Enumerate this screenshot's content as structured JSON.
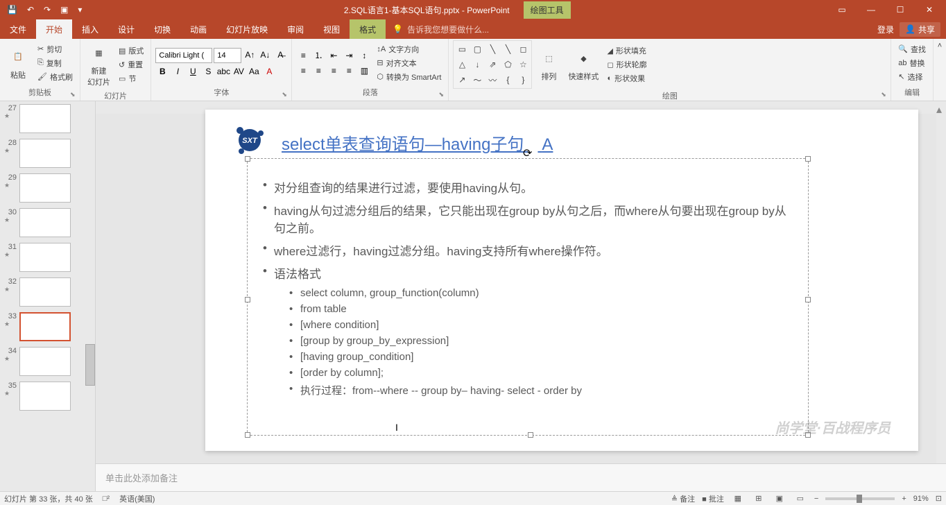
{
  "titlebar": {
    "doc_title": "2.SQL语言1-基本SQL语句.pptx - PowerPoint",
    "tool_context": "绘图工具"
  },
  "tabs": {
    "file": "文件",
    "home": "开始",
    "insert": "插入",
    "design": "设计",
    "transitions": "切换",
    "animations": "动画",
    "slideshow": "幻灯片放映",
    "review": "审阅",
    "view": "视图",
    "format": "格式",
    "tell_me": "告诉我您想要做什么...",
    "login": "登录",
    "share": "共享"
  },
  "ribbon": {
    "clipboard": {
      "label": "剪贴板",
      "paste": "粘贴",
      "cut": "剪切",
      "copy": "复制",
      "format_painter": "格式刷"
    },
    "slides": {
      "label": "幻灯片",
      "new_slide": "新建\n幻灯片",
      "layout": "版式",
      "reset": "重置",
      "section": "节"
    },
    "font": {
      "label": "字体",
      "family": "Calibri Light (",
      "size": "14"
    },
    "paragraph": {
      "label": "段落",
      "direction": "文字方向",
      "align_text": "对齐文本",
      "smartart": "转换为 SmartArt"
    },
    "drawing": {
      "label": "绘图",
      "arrange": "排列",
      "quick_styles": "快速样式",
      "fill": "形状填充",
      "outline": "形状轮廓",
      "effects": "形状效果"
    },
    "editing": {
      "label": "编辑",
      "find": "查找",
      "replace": "替换",
      "select": "选择"
    }
  },
  "thumbs": [
    {
      "num": "27"
    },
    {
      "num": "28"
    },
    {
      "num": "29"
    },
    {
      "num": "30"
    },
    {
      "num": "31"
    },
    {
      "num": "32"
    },
    {
      "num": "33",
      "selected": true
    },
    {
      "num": "34"
    },
    {
      "num": "35"
    }
  ],
  "slide": {
    "title": "select单表查询语句—having子句",
    "title_suffix": "A",
    "bullets_l1": [
      "对分组查询的结果进行过滤，要使用having从句。",
      "having从句过滤分组后的结果，它只能出现在group by从句之后，而where从句要出现在group by从句之前。",
      "where过滤行，having过滤分组。having支持所有where操作符。",
      "语法格式"
    ],
    "bullets_l2": [
      "select column, group_function(column)",
      "from table",
      "[where condition]",
      "[group by  group_by_expression]",
      "[having group_condition]",
      "[order by column];",
      "执行过程：from--where -- group  by– having- select - order  by"
    ],
    "watermark": "尚学堂·百战程序员"
  },
  "notes": {
    "placeholder": "单击此处添加备注"
  },
  "status": {
    "slide_info": "幻灯片 第 33 张，共 40 张",
    "lang": "英语(美国)",
    "notes_btn": "备注",
    "comments_btn": "批注",
    "zoom": "91%"
  }
}
